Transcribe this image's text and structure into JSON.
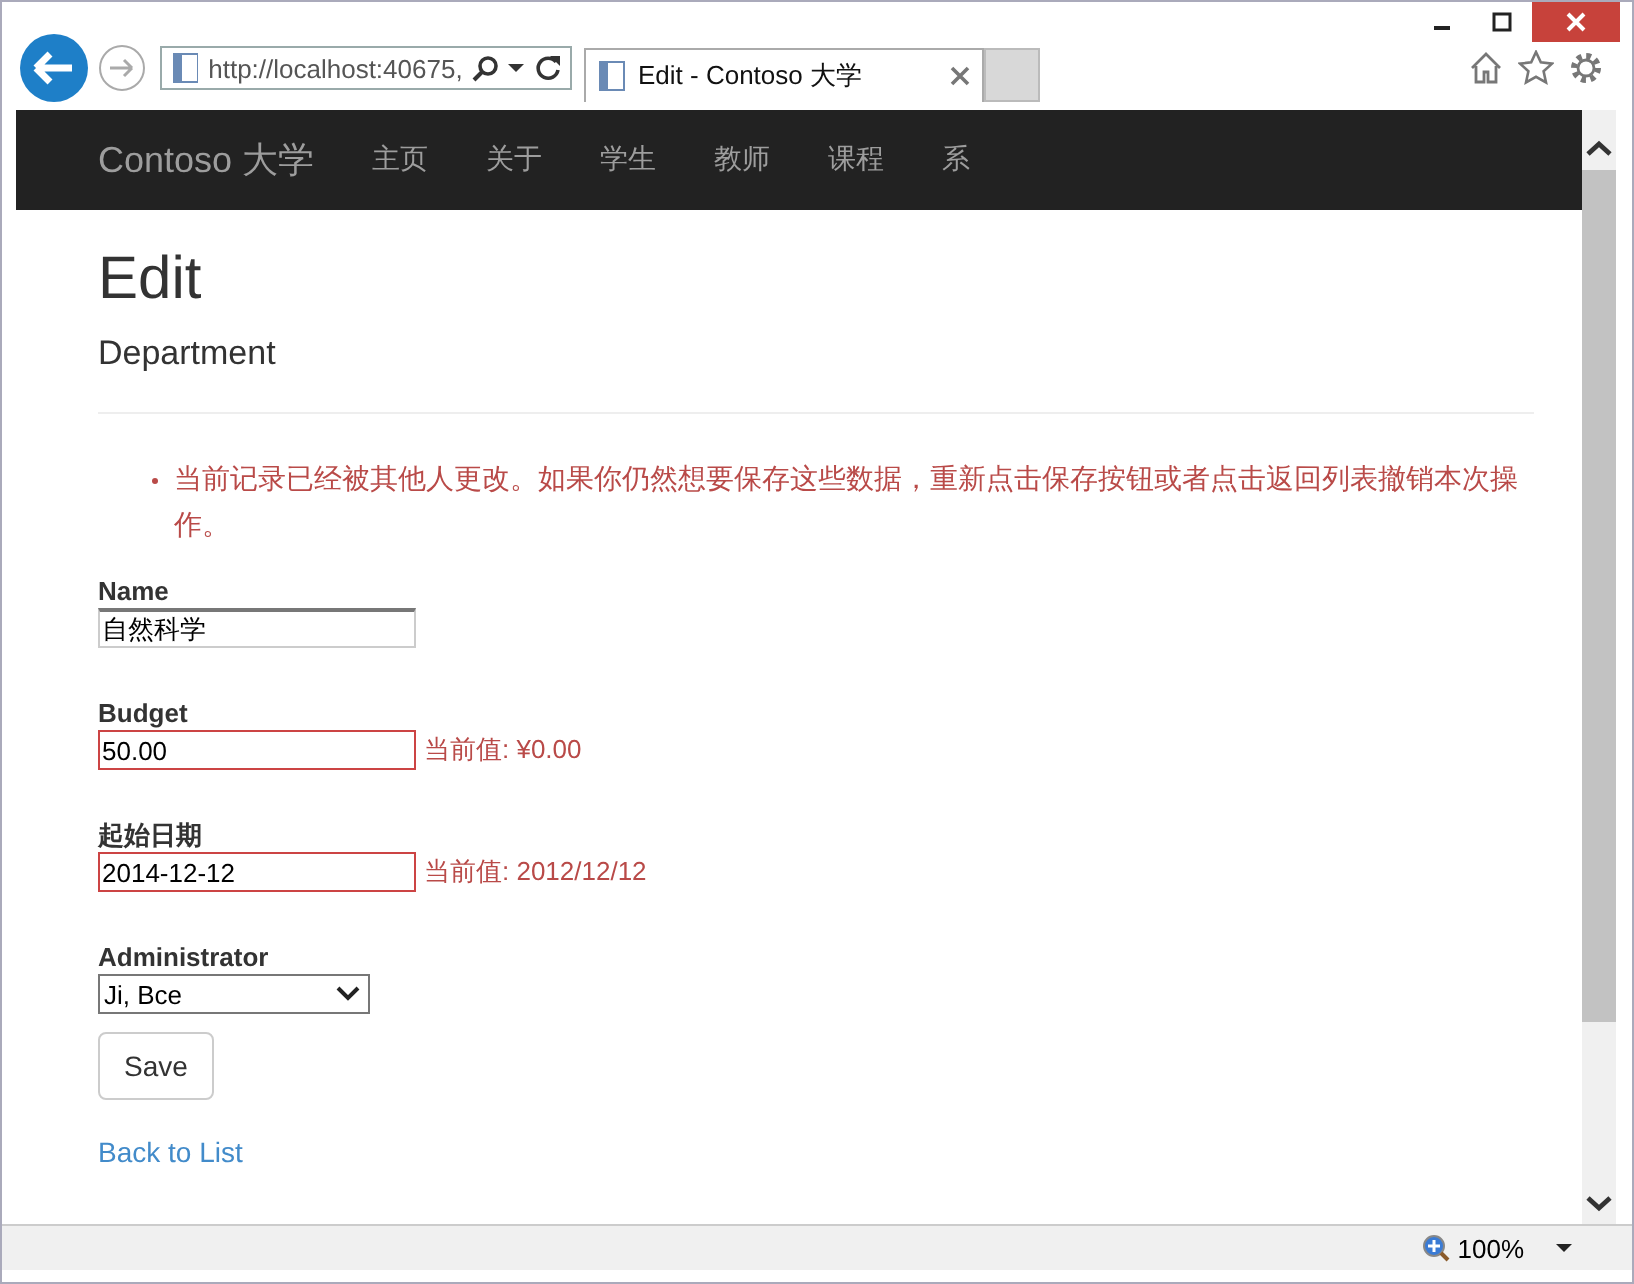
{
  "browser": {
    "address": "http://localhost:40675,",
    "tab_title": "Edit - Contoso 大学"
  },
  "nav": {
    "brand": "Contoso 大学",
    "items": [
      "主页",
      "关于",
      "学生",
      "教师",
      "课程",
      "系"
    ]
  },
  "page": {
    "title": "Edit",
    "subtitle": "Department"
  },
  "errors": [
    "当前记录已经被其他人更改。如果你仍然想要保存这些数据，重新点击保存按钮或者点击返回列表撤销本次操作。"
  ],
  "fields": [
    {
      "kind": "text",
      "label": "Name",
      "value": "自然科学",
      "invalid": false
    },
    {
      "kind": "text",
      "label": "Budget",
      "value": "50.00",
      "invalid": true,
      "message": "当前值: ¥0.00"
    },
    {
      "kind": "text",
      "label": "起始日期",
      "value": "2014-12-12",
      "invalid": true,
      "message": "当前值: 2012/12/12"
    },
    {
      "kind": "select",
      "label": "Administrator",
      "value": "Ji, Bce"
    }
  ],
  "save_button": "Save",
  "back_link": "Back to List",
  "status_bar": {
    "zoom": "100%"
  }
}
